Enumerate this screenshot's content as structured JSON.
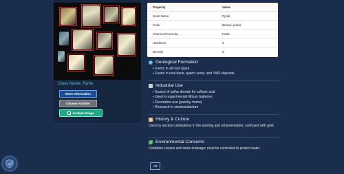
{
  "result": {
    "class_label": "Class Name: Pyrite",
    "buttons": {
      "more_info": "More Information",
      "choose_another": "Choose Another",
      "analyze": "Analyze Image"
    }
  },
  "table": {
    "headers": [
      "Property",
      "Value"
    ],
    "rows": [
      [
        "Rock Name",
        "Pyrite"
      ],
      [
        "Color",
        "Brassy yellow"
      ],
      [
        "Chemical Formula",
        "FeS2"
      ],
      [
        "Hardness",
        "6"
      ],
      [
        "Density",
        "5"
      ]
    ]
  },
  "sections": {
    "geological": {
      "title": "Geological Formation",
      "items": [
        "Forms in all rock types",
        "Found in coal beds, quartz veins, and VMS deposits"
      ]
    },
    "industrial": {
      "title": "Industrial Use",
      "items": [
        "Source of sulfur dioxide for sulfuric acid",
        "Used in experimental lithium batteries",
        "Decorative use (jewelry, home)",
        "Research in semiconductors"
      ]
    },
    "history": {
      "title": "History & Culture",
      "text": "Used by ancient civilizations in fire-starting and ornamentation; confused with gold."
    },
    "environment": {
      "title": "Environmental Concerns",
      "text": "Oxidation causes acid mine drainage; must be controlled to protect water."
    }
  },
  "footer": {
    "all_label": "All"
  },
  "colors": {
    "accent": "#56c6d6",
    "background": "#1b2d4d",
    "analyze": "#1fa883",
    "bbox": "#e02020"
  }
}
